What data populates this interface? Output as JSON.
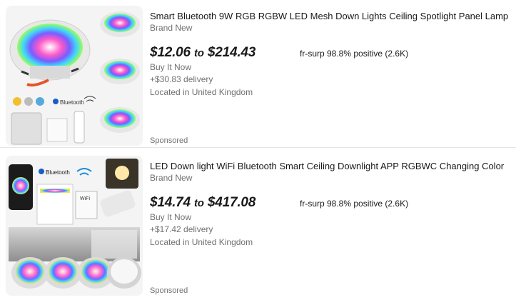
{
  "listings": [
    {
      "title": "Smart Bluetooth 9W RGB RGBW LED Mesh Down Lights Ceiling Spotlight Panel Lamp",
      "condition": "Brand New",
      "price_low": "$12.06",
      "price_to": "to",
      "price_high": "$214.43",
      "seller": "fr-surp 98.8% positive (2.6K)",
      "buy_format": "Buy It Now",
      "delivery": "+$30.83 delivery",
      "location": "Located in United Kingdom",
      "sponsored": "Sponsored",
      "image_text": {
        "bluetooth": "Bluetooth"
      }
    },
    {
      "title": "LED Down light WiFi Bluetooth Smart Ceiling Downlight APP RGBWC Changing Color",
      "condition": "Brand New",
      "price_low": "$14.74",
      "price_to": "to",
      "price_high": "$417.08",
      "seller": "fr-surp 98.8% positive (2.6K)",
      "buy_format": "Buy It Now",
      "delivery": "+$17.42 delivery",
      "location": "Located in United Kingdom",
      "sponsored": "Sponsored",
      "image_text": {
        "bluetooth": "Bluetooth",
        "wifi": "WiFi"
      }
    }
  ]
}
